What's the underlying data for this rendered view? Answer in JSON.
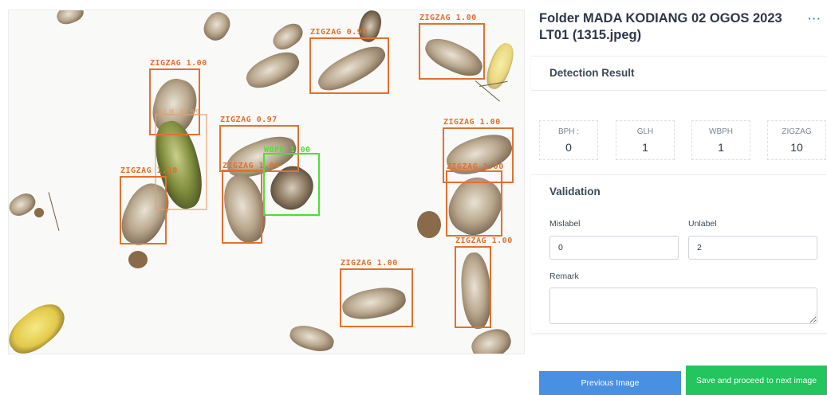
{
  "page": {
    "title": "Folder MADA KODIANG 02 OGOS 2023 LT01 (1315.jpeg)",
    "more_icon": "ellipsis-icon"
  },
  "image": {
    "detections": [
      {
        "label": "ZIGZAG 0.90",
        "color": "#e2702f"
      },
      {
        "label": "ZIGZAG 1.00",
        "color": "#e2702f"
      },
      {
        "label": "ZIGZAG 1.00",
        "color": "#e2702f"
      },
      {
        "label": "GLH 0.99",
        "color": "#e2a06e"
      },
      {
        "label": "ZIGZAG 0.97",
        "color": "#e2702f"
      },
      {
        "label": "WBPH 1.00",
        "color": "#4fdc3c"
      },
      {
        "label": "ZIGZAG 1.00",
        "color": "#e2702f"
      },
      {
        "label": "ZIGZAG 1.00",
        "color": "#e2702f"
      },
      {
        "label": "ZIGZAG 1.00",
        "color": "#e2702f"
      },
      {
        "label": "ZIGZAG 1.00",
        "color": "#e2702f"
      },
      {
        "label": "ZIGZAG 1.00",
        "color": "#e2702f"
      },
      {
        "label": "ZIGZAG 1.00",
        "color": "#e2702f"
      }
    ]
  },
  "detection": {
    "header": "Detection Result",
    "stats": [
      {
        "label": "BPH :",
        "value": "0"
      },
      {
        "label": "GLH",
        "value": "1"
      },
      {
        "label": "WBPH",
        "value": "1"
      },
      {
        "label": "ZIGZAG",
        "value": "10"
      }
    ]
  },
  "validation": {
    "header": "Validation",
    "mislabel_label": "Mislabel",
    "mislabel_value": "0",
    "unlabel_label": "Unlabel",
    "unlabel_value": "2",
    "remark_label": "Remark",
    "remark_value": ""
  },
  "actions": {
    "previous_label": "Previous Image",
    "next_label": "Save and proceed to next image"
  },
  "colors": {
    "previous_button": "#4a90e2",
    "next_button": "#22c55e",
    "box_orange": "#e2702f",
    "box_green": "#4fdc3c"
  }
}
